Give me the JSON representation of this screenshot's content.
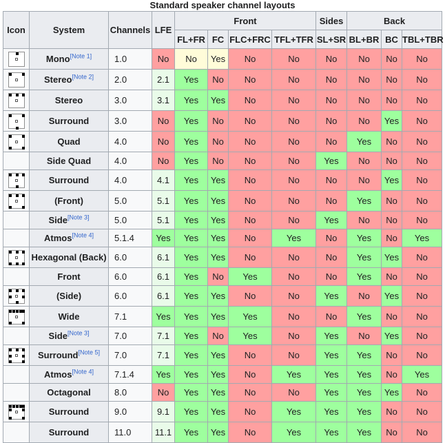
{
  "caption": "Standard speaker channel layouts",
  "header": {
    "icon": "Icon",
    "system": "System",
    "channels": "Channels",
    "lfe": "LFE",
    "groups": {
      "front": "Front",
      "sides": "Sides",
      "back": "Back"
    },
    "sub": [
      "FL+FR",
      "FC",
      "FLC+FRC",
      "TFL+TFR",
      "SL+SR",
      "BL+BR",
      "BC",
      "TBL+TBR"
    ]
  },
  "rows": [
    {
      "system": "Mono",
      "note": "[Note 1]",
      "channels": "1.0",
      "icon": "speaker-layout-mono-icon",
      "cells": [
        "No",
        "No",
        "Yes",
        "No",
        "No",
        "No",
        "No",
        "No",
        "No"
      ]
    },
    {
      "system": "Stereo",
      "note": "[Note 2]",
      "channels": "2.0",
      "icon": "speaker-layout-stereo-icon",
      "cells": [
        "2.1",
        "Yes",
        "No",
        "No",
        "No",
        "No",
        "No",
        "No",
        "No"
      ]
    },
    {
      "system": "Stereo",
      "note": "",
      "channels": "3.0",
      "icon": "speaker-layout-stereo-3-icon",
      "cells": [
        "3.1",
        "Yes",
        "Yes",
        "No",
        "No",
        "No",
        "No",
        "No",
        "No"
      ]
    },
    {
      "system": "Surround",
      "note": "",
      "channels": "3.0",
      "icon": "speaker-layout-surround-3-icon",
      "cells": [
        "No",
        "Yes",
        "No",
        "No",
        "No",
        "No",
        "No",
        "Yes",
        "No"
      ]
    },
    {
      "system": "Quad",
      "note": "",
      "channels": "4.0",
      "icon": "speaker-layout-quad-icon",
      "cells": [
        "No",
        "Yes",
        "No",
        "No",
        "No",
        "No",
        "Yes",
        "No",
        "No"
      ]
    },
    {
      "system": "Side Quad",
      "note": "",
      "channels": "4.0",
      "icon": "",
      "cells": [
        "No",
        "Yes",
        "No",
        "No",
        "No",
        "Yes",
        "No",
        "No",
        "No"
      ]
    },
    {
      "system": "Surround",
      "note": "",
      "channels": "4.0",
      "icon": "speaker-layout-surround-4-icon",
      "cells": [
        "4.1",
        "Yes",
        "Yes",
        "No",
        "No",
        "No",
        "No",
        "Yes",
        "No"
      ]
    },
    {
      "system": "(Front)",
      "note": "",
      "channels": "5.0",
      "icon": "speaker-layout-front-5-icon",
      "cells": [
        "5.1",
        "Yes",
        "Yes",
        "No",
        "No",
        "No",
        "Yes",
        "No",
        "No"
      ]
    },
    {
      "system": "Side",
      "note": "[Note 3]",
      "channels": "5.0",
      "icon": "",
      "cells": [
        "5.1",
        "Yes",
        "Yes",
        "No",
        "No",
        "Yes",
        "No",
        "No",
        "No"
      ]
    },
    {
      "system": "Atmos",
      "note": "[Note 4]",
      "channels": "5.1.4",
      "icon": "",
      "cells": [
        "Yes",
        "Yes",
        "Yes",
        "No",
        "Yes",
        "No",
        "Yes",
        "No",
        "Yes"
      ]
    },
    {
      "system": "Hexagonal (Back)",
      "note": "",
      "channels": "6.0",
      "icon": "speaker-layout-hexagonal-icon",
      "cells": [
        "6.1",
        "Yes",
        "Yes",
        "No",
        "No",
        "No",
        "Yes",
        "Yes",
        "No"
      ]
    },
    {
      "system": "Front",
      "note": "",
      "channels": "6.0",
      "icon": "",
      "cells": [
        "6.1",
        "Yes",
        "No",
        "Yes",
        "No",
        "No",
        "Yes",
        "No",
        "No"
      ]
    },
    {
      "system": "(Side)",
      "note": "",
      "channels": "6.0",
      "icon": "speaker-layout-side-6-icon",
      "cells": [
        "6.1",
        "Yes",
        "Yes",
        "No",
        "No",
        "Yes",
        "No",
        "Yes",
        "No"
      ]
    },
    {
      "system": "Wide",
      "note": "",
      "channels": "7.1",
      "icon": "speaker-layout-wide-icon",
      "cells": [
        "Yes",
        "Yes",
        "Yes",
        "Yes",
        "No",
        "No",
        "Yes",
        "No",
        "No"
      ]
    },
    {
      "system": "Side",
      "note": "[Note 3]",
      "channels": "7.0",
      "icon": "",
      "cells": [
        "7.1",
        "Yes",
        "No",
        "Yes",
        "No",
        "Yes",
        "No",
        "Yes",
        "No"
      ]
    },
    {
      "system": "Surround",
      "note": "[Note 5]",
      "channels": "7.0",
      "icon": "speaker-layout-surround-7-icon",
      "cells": [
        "7.1",
        "Yes",
        "Yes",
        "No",
        "No",
        "Yes",
        "Yes",
        "No",
        "No"
      ]
    },
    {
      "system": "Atmos",
      "note": "[Note 4]",
      "channels": "7.1.4",
      "icon": "",
      "cells": [
        "Yes",
        "Yes",
        "Yes",
        "No",
        "Yes",
        "Yes",
        "Yes",
        "No",
        "Yes"
      ]
    },
    {
      "system": "Octagonal",
      "note": "",
      "channels": "8.0",
      "icon": "",
      "cells": [
        "No",
        "Yes",
        "Yes",
        "No",
        "No",
        "Yes",
        "Yes",
        "Yes",
        "No"
      ]
    },
    {
      "system": "Surround",
      "note": "",
      "channels": "9.0",
      "icon": "speaker-layout-surround-9-icon",
      "cells": [
        "9.1",
        "Yes",
        "Yes",
        "No",
        "Yes",
        "Yes",
        "Yes",
        "No",
        "No"
      ]
    },
    {
      "system": "Surround",
      "note": "",
      "channels": "11.0",
      "icon": "",
      "cells": [
        "11.1",
        "Yes",
        "Yes",
        "No",
        "Yes",
        "Yes",
        "Yes",
        "No",
        "No"
      ]
    }
  ],
  "colors": {
    "yes": "#9eff9e",
    "no": "#ffa0a0",
    "header": "#eaecf0",
    "border": "#a2a9b1"
  }
}
